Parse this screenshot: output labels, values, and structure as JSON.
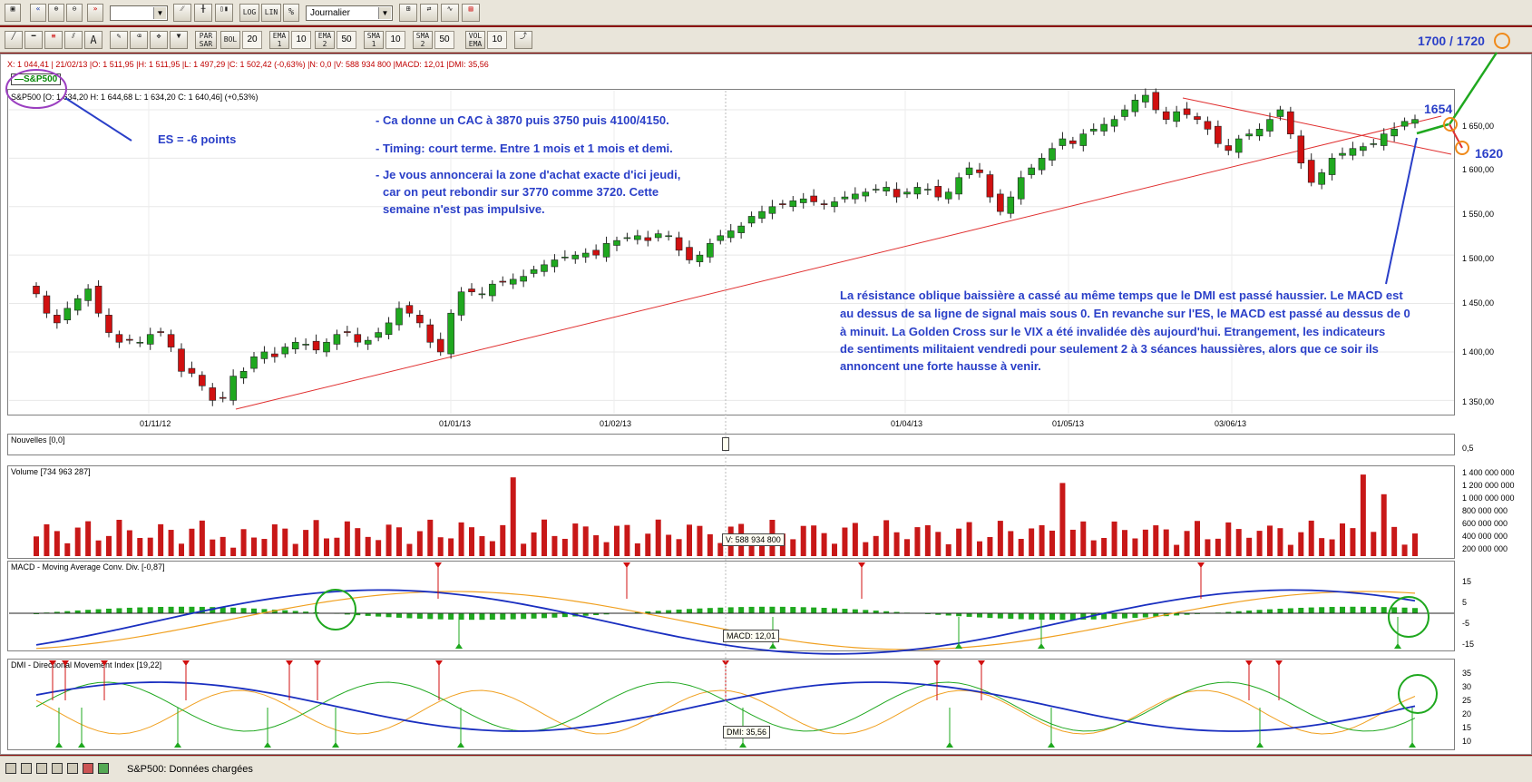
{
  "toolbar": {
    "period": "Journalier",
    "btn_log": "LOG",
    "btn_lin": "LIN",
    "btn_pct": "%",
    "btn_par": "PAR SAR",
    "btn_bol": "BOL",
    "bol_val": "20",
    "btn_ema1": "EMA 1",
    "ema1_val": "10",
    "btn_ema2": "EMA 2",
    "ema2_val": "50",
    "btn_sma1": "SMA 1",
    "sma1_val": "10",
    "btn_sma2": "SMA 2",
    "sma2_val": "50",
    "btn_vol": "VOL EMA",
    "vol_val": "10"
  },
  "info_line": "X: 1 044,41 | 21/02/13 |O: 1 511,95 |H: 1 511,95 |L: 1 497,29 |C: 1 502,42 (-0,63%) |N: 0,0 |V: 588 934 800 |MACD: 12,01 |DMI: 35,56",
  "legend_tag": "S&P500",
  "main_panel": {
    "ohlc": "S&P500 [O: 1 634,20  H: 1 644,68  L: 1 634,20  C: 1 640,46] (+0,53%)",
    "y_ticks": [
      "1 650,00",
      "1 600,00",
      "1 550,00",
      "1 500,00",
      "1 450,00",
      "1 400,00",
      "1 350,00"
    ],
    "x_ticks": [
      "01/11/12",
      "01/01/13",
      "01/02/13",
      "01/04/13",
      "01/05/13",
      "03/06/13"
    ]
  },
  "annotations": {
    "es": "ES = -6 points",
    "bullets": [
      "- Ca donne un CAC à 3870 puis 3750 puis 4100/4150.",
      "- Timing: court terme. Entre 1 mois et 1 mois et demi.",
      "- Je vous annoncerai la zone d'achat exacte d'ici jeudi,",
      "car on peut rebondir sur 3770 comme 3720. Cette",
      "semaine n'est pas impulsive."
    ],
    "paragraph": [
      "La résistance oblique baissière a cassé au même temps que le DMI est passé haussier. Le MACD est",
      "au dessus de sa ligne de signal mais sous 0. En revanche sur l'ES, le MACD est passé au dessus de 0",
      "à minuit. La Golden Cross sur le VIX a été invalidée dès aujourd'hui. Etrangement, les indicateurs",
      "de sentiments militaient vendredi pour seulement 2 à 3 séances haussières, alors que ce soir ils",
      "annoncent une forte hausse à venir."
    ],
    "target_top": "1700 / 1720",
    "level_1654": "1654",
    "level_1620": "1620"
  },
  "nouvelles": {
    "title": "Nouvelles [0,0]",
    "tick": "0,5"
  },
  "volume": {
    "title": "Volume [734 963 287]",
    "y_ticks": [
      "1 400 000 000",
      "1 200 000 000",
      "1 000 000 000",
      "800 000 000",
      "600 000 000",
      "400 000 000",
      "200 000 000"
    ],
    "cursor_label": "V: 588 934 800"
  },
  "macd": {
    "title": "MACD - Moving Average Conv. Div. [-0,87]",
    "y_ticks": [
      "15",
      "5",
      "-5",
      "-15"
    ],
    "cursor_label": "MACD: 12,01"
  },
  "dmi": {
    "title": "DMI - Directional Movement Index [19,22]",
    "y_ticks": [
      "35",
      "30",
      "25",
      "20",
      "15",
      "10"
    ],
    "cursor_label": "DMI: 35,56"
  },
  "status": {
    "text": "S&P500: Données chargées"
  },
  "colors": {
    "up": "#1fa81f",
    "down": "#d01010",
    "annot": "#2a3fc8",
    "frame": "#8c0c0c"
  },
  "chart_data": {
    "type": "candlestick",
    "title": "S&P500",
    "x_labels": [
      "01/11/12",
      "01/01/13",
      "01/02/13",
      "01/04/13",
      "01/05/13",
      "03/06/13"
    ],
    "ylim": [
      1340,
      1665
    ],
    "close_series_approx": [
      1460,
      1440,
      1430,
      1445,
      1455,
      1465,
      1440,
      1420,
      1410,
      1412,
      1410,
      1418,
      1420,
      1405,
      1380,
      1378,
      1365,
      1350,
      1352,
      1375,
      1380,
      1395,
      1400,
      1395,
      1405,
      1410,
      1408,
      1402,
      1410,
      1418,
      1420,
      1410,
      1412,
      1420,
      1430,
      1445,
      1440,
      1430,
      1410,
      1400,
      1440,
      1462,
      1462,
      1460,
      1470,
      1472,
      1475,
      1478,
      1485,
      1490,
      1495,
      1498,
      1500,
      1502,
      1500,
      1512,
      1515,
      1518,
      1520,
      1515,
      1522,
      1520,
      1505,
      1495,
      1500,
      1512,
      1520,
      1525,
      1530,
      1540,
      1545,
      1550,
      1552,
      1556,
      1558,
      1555,
      1552,
      1555,
      1560,
      1563,
      1565,
      1568,
      1570,
      1560,
      1565,
      1570,
      1568,
      1560,
      1565,
      1580,
      1590,
      1585,
      1560,
      1545,
      1560,
      1580,
      1590,
      1600,
      1610,
      1620,
      1615,
      1625,
      1630,
      1635,
      1640,
      1650,
      1660,
      1665,
      1650,
      1640,
      1648,
      1645,
      1640,
      1630,
      1615,
      1608,
      1620,
      1625,
      1630,
      1640,
      1650,
      1625,
      1595,
      1575,
      1585,
      1600,
      1605,
      1610,
      1612,
      1615,
      1625,
      1630,
      1638,
      1640
    ]
  }
}
